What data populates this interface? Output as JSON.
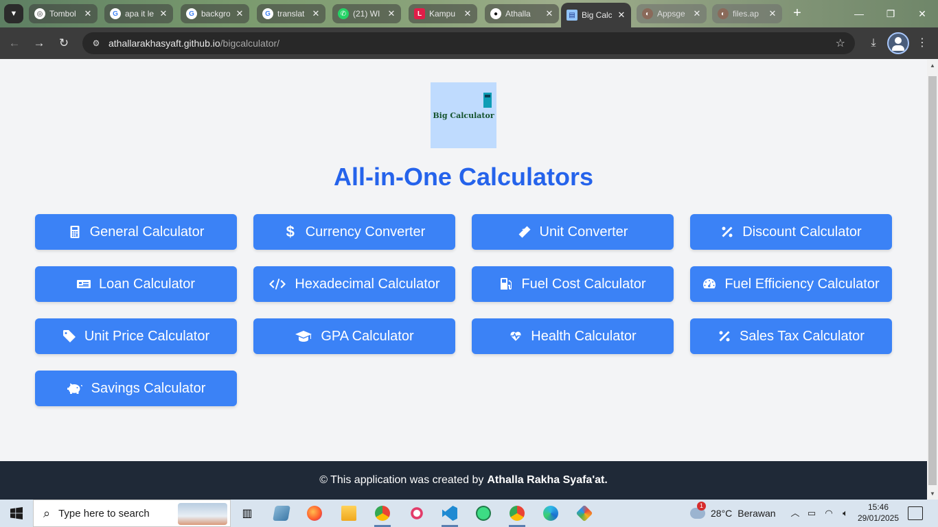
{
  "browser": {
    "tabs": [
      {
        "title": "Tombol",
        "favicon": "chatgpt-icon",
        "color": "#ffffff"
      },
      {
        "title": "apa it le",
        "favicon": "google-icon",
        "color": "#ffffff"
      },
      {
        "title": "backgro",
        "favicon": "google-icon",
        "color": "#ffffff"
      },
      {
        "title": "translat",
        "favicon": "google-icon",
        "color": "#ffffff"
      },
      {
        "title": "(21) WI",
        "favicon": "whatsapp-icon",
        "color": "#25d366"
      },
      {
        "title": "Kampu",
        "favicon": "kampus-icon",
        "color": "#e11d48"
      },
      {
        "title": "Athalla",
        "favicon": "github-icon",
        "color": "#ffffff"
      },
      {
        "title": "Big Calc",
        "favicon": "calculator-icon",
        "color": "#60a5fa"
      },
      {
        "title": "Appsge",
        "favicon": "appsgeyser-icon",
        "color": "#c2410c"
      },
      {
        "title": "files.ap",
        "favicon": "appsgeyser-icon",
        "color": "#c2410c"
      }
    ],
    "url_host": "athallarakhasyaft.github.io",
    "url_path": "/bigcalculator/"
  },
  "page": {
    "logo_text": "Big Calculator",
    "title": "All-in-One Calculators",
    "calculators": [
      {
        "label": "General Calculator",
        "icon": "calculator-icon"
      },
      {
        "label": "Currency Converter",
        "icon": "dollar-icon"
      },
      {
        "label": "Unit Converter",
        "icon": "ruler-icon"
      },
      {
        "label": "Discount Calculator",
        "icon": "percent-icon"
      },
      {
        "label": "Loan Calculator",
        "icon": "money-check-icon"
      },
      {
        "label": "Hexadecimal Calculator",
        "icon": "code-icon"
      },
      {
        "label": "Fuel Cost Calculator",
        "icon": "gas-pump-icon"
      },
      {
        "label": "Fuel Efficiency Calculator",
        "icon": "gauge-icon"
      },
      {
        "label": "Unit Price Calculator",
        "icon": "tag-icon"
      },
      {
        "label": "GPA Calculator",
        "icon": "graduation-cap-icon"
      },
      {
        "label": "Health Calculator",
        "icon": "heartbeat-icon"
      },
      {
        "label": "Sales Tax Calculator",
        "icon": "percent-icon"
      },
      {
        "label": "Savings Calculator",
        "icon": "piggy-bank-icon"
      }
    ],
    "footer_prefix": "© This application was created by",
    "footer_author": "Athalla Rakha Syafa'at."
  },
  "taskbar": {
    "search_placeholder": "Type here to search",
    "weather_temp": "28°C",
    "weather_desc": "Berawan",
    "weather_badge": "1",
    "time": "15:46",
    "date": "29/01/2025"
  },
  "colors": {
    "accent": "#2563eb",
    "button": "#3b82f6",
    "footer": "#1f2937"
  }
}
